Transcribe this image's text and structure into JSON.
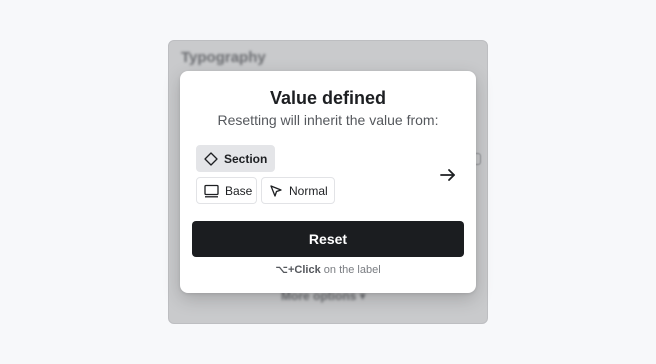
{
  "background_panel": {
    "title": "Typography",
    "footer": "More options ▾"
  },
  "popover": {
    "title": "Value defined",
    "subtitle": "Resetting will inherit the value from:",
    "sources": [
      {
        "label": "Section",
        "icon": "diamond-icon",
        "selected": true
      },
      {
        "label": "Base",
        "icon": "monitor-icon",
        "selected": false
      },
      {
        "label": "Normal",
        "icon": "cursor-pointer-icon",
        "selected": false
      }
    ],
    "arrow_icon": "arrow-right-icon",
    "reset_label": "Reset",
    "hint_shortcut": "⌥+Click",
    "hint_text": " on the label"
  },
  "colors": {
    "button_bg": "#1b1d20",
    "selected_chip_bg": "#e4e5e8",
    "page_bg": "#f7f8fa"
  }
}
